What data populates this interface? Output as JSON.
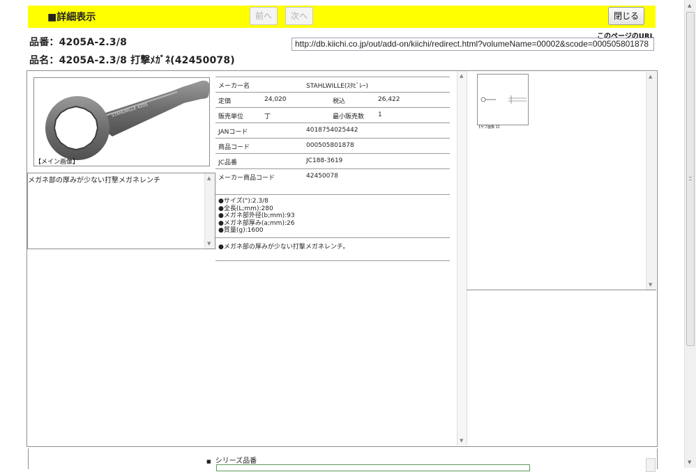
{
  "header": {
    "title": "■詳細表示",
    "prev_label": "前へ",
    "next_label": "次へ",
    "close_label": "閉じる"
  },
  "product": {
    "code_line": "品番：4205A-2.3/8",
    "name_line": "品名：4205A-2.3/8 打撃ﾒｶﾞﾈ(42450078)"
  },
  "page_url": {
    "label": "このページのURL",
    "value": "http://db.kiichi.co.jp/out/add-on/kiichi/redirect.html?volumeName=00002&scode=000505801878"
  },
  "main_image": {
    "caption": "【メイン画像】",
    "stamp": "STAHLWILLE 4205"
  },
  "description_box": {
    "text": "メガネ部の厚みが少ない打撃メガネレンチ"
  },
  "specs": {
    "maker_label": "メーカー名",
    "maker_value": "STAHLWILLE(ｽﾀﾋﾞﾚｰ)",
    "price_label": "定価",
    "price_value": "24,020",
    "tax_label": "税込",
    "tax_value": "26,422",
    "unit_label": "販売単位",
    "unit_value": "丁",
    "minqty_label": "最小販売数",
    "minqty_value": "1",
    "jan_label": "JANコード",
    "jan_value": "4018754025442",
    "product_code_label": "商品コード",
    "product_code_value": "000505801878",
    "jc_label": "JC品番",
    "jc_value": "JC188-3619",
    "maker_code_label": "メーカー商品コード",
    "maker_code_value": "42450078",
    "bullets": [
      "●サイズ(\"):2.3/8",
      "●全長(L;mm):280",
      "●メガネ部外径(b;mm):93",
      "●メガネ部厚み(a;mm):26",
      "●質量(g):1600"
    ],
    "note": "●メガネ部の厚みが少ない打撃メガネレンチ。"
  },
  "sub_image": {
    "caption": "【サブ画像 1】"
  },
  "series": {
    "label": "シリーズ品番"
  }
}
